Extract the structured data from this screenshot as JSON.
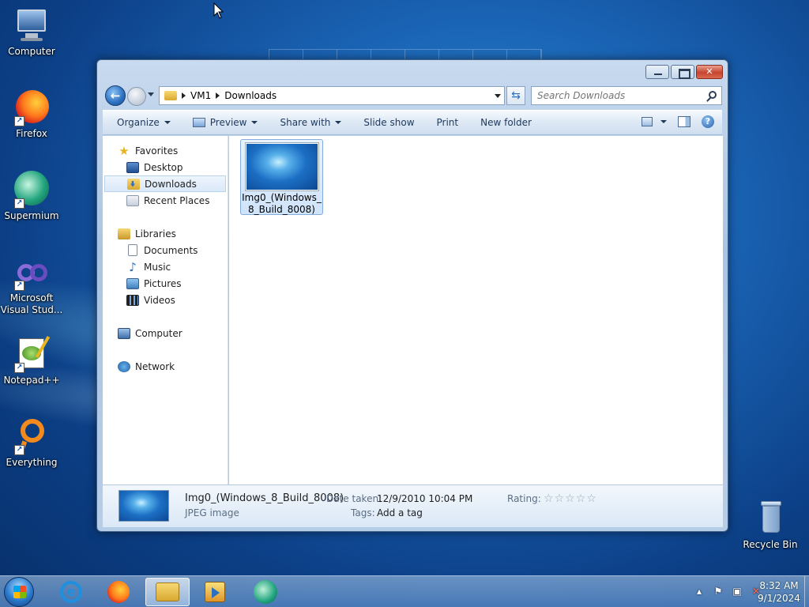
{
  "desktop": {
    "icons": [
      {
        "label": "Computer",
        "icon": "computer-icon"
      },
      {
        "label": "Firefox",
        "icon": "firefox-icon"
      },
      {
        "label": "Supermium",
        "icon": "supermium-icon"
      },
      {
        "label": "Microsoft Visual Stud...",
        "icon": "visual-studio-icon"
      },
      {
        "label": "Notepad++",
        "icon": "notepad-plus-plus-icon"
      },
      {
        "label": "Everything",
        "icon": "everything-icon"
      },
      {
        "label": "Recycle Bin",
        "icon": "recycle-bin-icon"
      }
    ]
  },
  "window": {
    "breadcrumb": [
      "VM1",
      "Downloads"
    ],
    "search_placeholder": "Search Downloads",
    "toolbar": {
      "organize": "Organize",
      "preview": "Preview",
      "share_with": "Share with",
      "slide_show": "Slide show",
      "print": "Print",
      "new_folder": "New folder"
    },
    "nav": {
      "favorites": "Favorites",
      "desktop": "Desktop",
      "downloads": "Downloads",
      "recent_places": "Recent Places",
      "libraries": "Libraries",
      "documents": "Documents",
      "music": "Music",
      "pictures": "Pictures",
      "videos": "Videos",
      "computer": "Computer",
      "network": "Network"
    },
    "files": [
      {
        "line1": "Img0_(Windows_",
        "line2": "8_Build_8008)"
      }
    ],
    "details": {
      "name": "Img0_(Windows_8_Build_8008)",
      "type": "JPEG image",
      "date_label": "Date taken:",
      "date_value": "12/9/2010 10:04 PM",
      "tags_label": "Tags:",
      "tags_value": "Add a tag",
      "rating_label": "Rating:",
      "rating_value": 0,
      "rating_max": 5
    }
  },
  "taskbar": {
    "apps": [
      "internet-explorer",
      "firefox",
      "windows-explorer",
      "media-player",
      "supermium"
    ],
    "active_app": "windows-explorer",
    "time": "8:32 AM",
    "date": "9/1/2024"
  },
  "colors": {
    "accent": "#2a6fc0",
    "selection": "#cfe3fa",
    "close_button": "#c64430"
  }
}
